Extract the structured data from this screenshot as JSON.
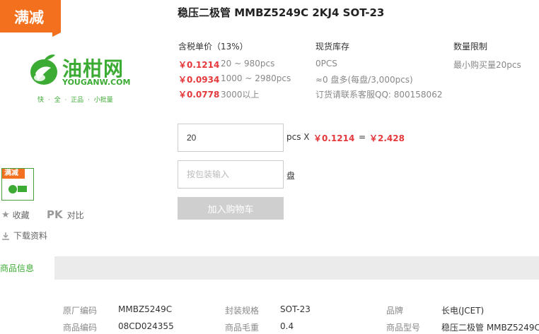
{
  "promo": {
    "label": "满减",
    "thumb_label": "满减"
  },
  "brand": {
    "logo_cn": "油柑网",
    "logo_en": "YOUGANW.COM",
    "slogan": "快 · 全 · 正品 · 小批量",
    "colors": {
      "green": "#3cab34",
      "orange": "#f2701e",
      "price_red": "#e4393c"
    }
  },
  "sidebar": {
    "favorite_label": "收藏",
    "pk_label": "PK",
    "compare_label": "对比",
    "download_label": "下载资料"
  },
  "product": {
    "title": "稳压二极管 MMBZ5249C 2KJ4 SOT-23",
    "price_header": "含税单价（13%）",
    "stock_header": "现货库存",
    "limit_header": "数量限制",
    "tiers": [
      {
        "price": "￥0.1214",
        "range": "20 ~ 980pcs"
      },
      {
        "price": "￥0.0934",
        "range": "1000 ~ 2980pcs"
      },
      {
        "price": "￥0.0778",
        "range": "3000以上"
      }
    ],
    "stock_lines": [
      "0PCS",
      "≈0 盘多(每盘/3,000pcs)",
      "订货请联系客服QQ: 800158062"
    ],
    "limit_text": "最小购买量20pcs"
  },
  "order": {
    "quantity": "20",
    "pcs_x": "pcs X",
    "unit_price": "￥0.1214",
    "equals": "=",
    "total": "￥2.428",
    "package_placeholder": "按包装输入",
    "package_unit": "盘",
    "add_to_cart": "加入购物车"
  },
  "tabs": {
    "active": "商品信息"
  },
  "specs": [
    {
      "k1": "原厂编码",
      "v1": "MMBZ5249C",
      "k2": "封装规格",
      "v2": "SOT-23",
      "k3": "品牌",
      "v3": "长电(JCET)"
    },
    {
      "k1": "商品编码",
      "v1": "08CD024355",
      "k2": "商品毛重",
      "v2": "0.4",
      "k3": "商品型号",
      "v3": "稳压二极管 MMBZ5249C"
    }
  ]
}
